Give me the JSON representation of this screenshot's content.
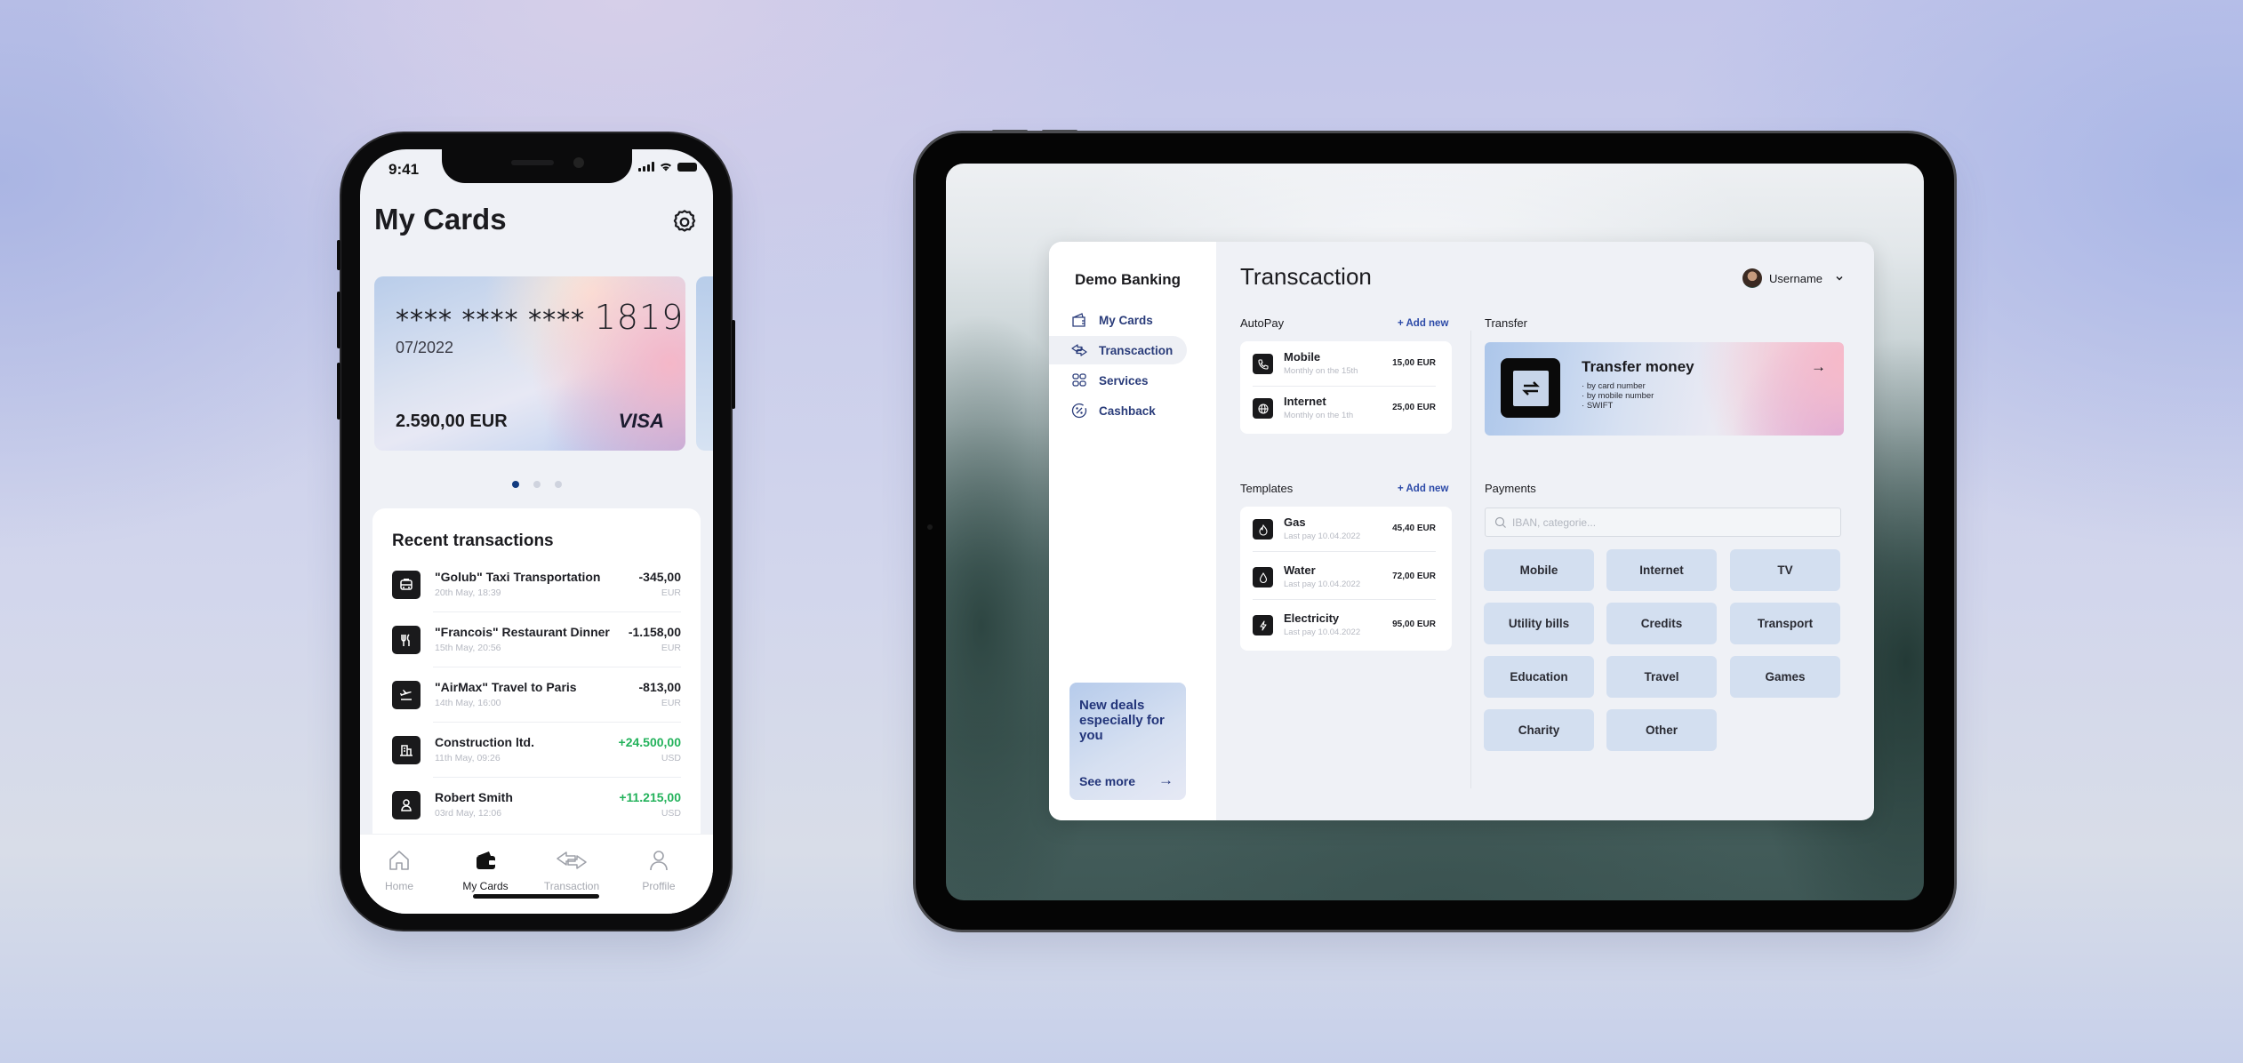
{
  "phone": {
    "status": {
      "time": "9:41"
    },
    "title": "My Cards",
    "card": {
      "masked_number": "**** **** ****",
      "last4": "1819",
      "expiry": "07/2022",
      "balance": "2.590,00 EUR",
      "network": "VISA"
    },
    "carousel": {
      "count": 3,
      "active": 0
    },
    "transactions": {
      "title": "Recent transactions",
      "items": [
        {
          "icon": "taxi-icon",
          "name": "\"Golub\" Taxi Transportation",
          "date": "20th May, 18:39",
          "amount": "-345,00",
          "currency": "EUR",
          "positive": false
        },
        {
          "icon": "restaurant-icon",
          "name": "\"Francois\" Restaurant Dinner",
          "date": "15th May, 20:56",
          "amount": "-1.158,00",
          "currency": "EUR",
          "positive": false
        },
        {
          "icon": "airplane-icon",
          "name": "\"AirMax\" Travel to Paris",
          "date": "14th May, 16:00",
          "amount": "-813,00",
          "currency": "EUR",
          "positive": false
        },
        {
          "icon": "building-icon",
          "name": "Construction ltd.",
          "date": "11th May, 09:26",
          "amount": "+24.500,00",
          "currency": "USD",
          "positive": true
        },
        {
          "icon": "person-icon",
          "name": "Robert Smith",
          "date": "03rd May, 12:06",
          "amount": "+11.215,00",
          "currency": "USD",
          "positive": true
        }
      ]
    },
    "tabbar": [
      {
        "label": "Home",
        "icon": "home-icon",
        "active": false
      },
      {
        "label": "My Cards",
        "icon": "wallet-icon",
        "active": true
      },
      {
        "label": "Transaction",
        "icon": "transfer-arrows-icon",
        "active": false
      },
      {
        "label": "Proffile",
        "icon": "user-icon",
        "active": false
      }
    ]
  },
  "tablet": {
    "sidebar": {
      "brand": "Demo Banking",
      "items": [
        {
          "label": "My Cards",
          "icon": "wallet-icon",
          "active": false
        },
        {
          "label": "Transcaction",
          "icon": "transfer-arrows-icon",
          "active": true
        },
        {
          "label": "Services",
          "icon": "grid-icon",
          "active": false
        },
        {
          "label": "Cashback",
          "icon": "percent-icon",
          "active": false
        }
      ],
      "promo": {
        "title": "New deals especially for you",
        "link": "See more"
      }
    },
    "header": {
      "title": "Transcaction",
      "username": "Username"
    },
    "autopay": {
      "label": "AutoPay",
      "add_label": "+ Add new",
      "items": [
        {
          "icon": "phone-icon",
          "name": "Mobile",
          "sub": "Monthly on the 15th",
          "amount": "15,00 EUR"
        },
        {
          "icon": "globe-icon",
          "name": "Internet",
          "sub": "Monthly on the 1th",
          "amount": "25,00 EUR"
        }
      ]
    },
    "templates": {
      "label": "Templates",
      "add_label": "+ Add new",
      "items": [
        {
          "icon": "flame-icon",
          "name": "Gas",
          "sub": "Last pay 10.04.2022",
          "amount": "45,40 EUR"
        },
        {
          "icon": "water-drop-icon",
          "name": "Water",
          "sub": "Last pay 10.04.2022",
          "amount": "72,00 EUR"
        },
        {
          "icon": "lightning-icon",
          "name": "Electricity",
          "sub": "Last pay 10.04.2022",
          "amount": "95,00 EUR"
        }
      ]
    },
    "transfer": {
      "label": "Transfer",
      "title": "Transfer money",
      "bullets": [
        "by card number",
        "by mobile number",
        "SWIFT"
      ]
    },
    "payments": {
      "label": "Payments",
      "search_placeholder": "IBAN, categorie...",
      "search_value": "",
      "categories": [
        "Mobile",
        "Internet",
        "TV",
        "Utility bills",
        "Credits",
        "Transport",
        "Education",
        "Travel",
        "Games",
        "Charity",
        "Other"
      ]
    }
  },
  "colors": {
    "accent": "#2C4AA8",
    "positive": "#23B25B",
    "nav_text": "#2A3C7A",
    "category_bg": "#D3DFF0"
  }
}
